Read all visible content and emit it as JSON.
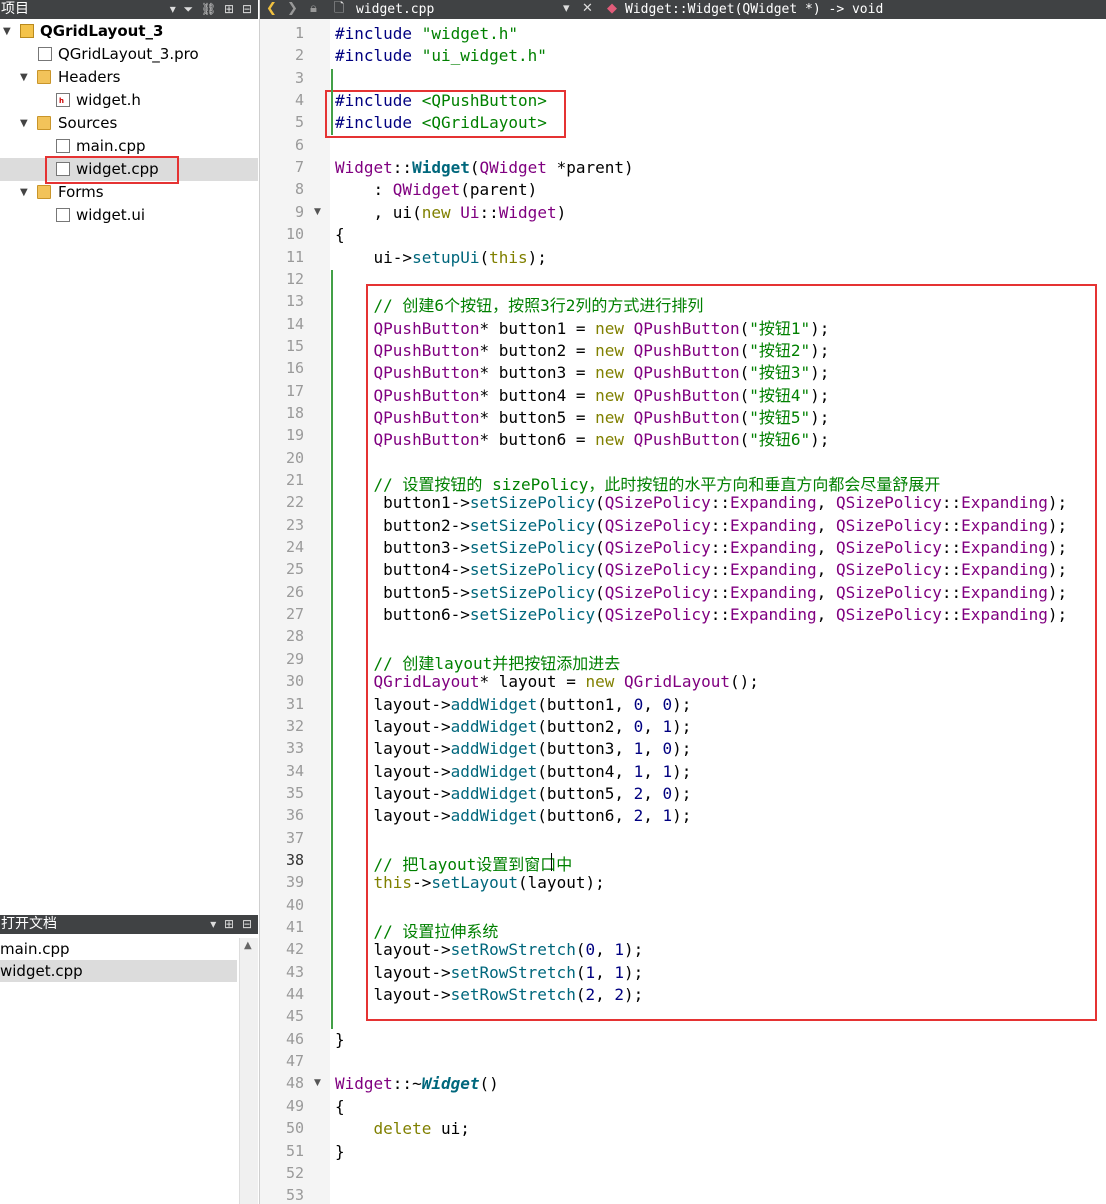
{
  "project_panel": {
    "title": "项目",
    "tree": [
      {
        "label": "QGridLayout_3",
        "kind": "project"
      },
      {
        "label": "QGridLayout_3.pro",
        "kind": "pro-file"
      },
      {
        "label": "Headers",
        "kind": "folder"
      },
      {
        "label": "widget.h",
        "kind": "header-file"
      },
      {
        "label": "Sources",
        "kind": "folder"
      },
      {
        "label": "main.cpp",
        "kind": "source-file"
      },
      {
        "label": "widget.cpp",
        "kind": "source-file",
        "selected": true
      },
      {
        "label": "Forms",
        "kind": "folder"
      },
      {
        "label": "widget.ui",
        "kind": "ui-file"
      }
    ]
  },
  "open_docs_panel": {
    "title": "打开文档",
    "items": [
      {
        "label": "main.cpp"
      },
      {
        "label": "widget.cpp",
        "selected": true
      }
    ]
  },
  "editor_toolbar": {
    "file_name": "widget.cpp",
    "function_path": "Widget::Widget(QWidget *) -> void"
  },
  "current_line": 38,
  "code_lines": [
    "#include \"widget.h\"",
    "#include \"ui_widget.h\"",
    "",
    "#include <QPushButton>",
    "#include <QGridLayout>",
    "",
    "Widget::Widget(QWidget *parent)",
    "    : QWidget(parent)",
    "    , ui(new Ui::Widget)",
    "{",
    "    ui->setupUi(this);",
    "",
    "    // 创建6个按钮，按照3行2列的方式进行排列",
    "    QPushButton* button1 = new QPushButton(\"按钮1\");",
    "    QPushButton* button2 = new QPushButton(\"按钮2\");",
    "    QPushButton* button3 = new QPushButton(\"按钮3\");",
    "    QPushButton* button4 = new QPushButton(\"按钮4\");",
    "    QPushButton* button5 = new QPushButton(\"按钮5\");",
    "    QPushButton* button6 = new QPushButton(\"按钮6\");",
    "",
    "    // 设置按钮的 sizePolicy，此时按钮的水平方向和垂直方向都会尽量舒展开",
    "     button1->setSizePolicy(QSizePolicy::Expanding, QSizePolicy::Expanding);",
    "     button2->setSizePolicy(QSizePolicy::Expanding, QSizePolicy::Expanding);",
    "     button3->setSizePolicy(QSizePolicy::Expanding, QSizePolicy::Expanding);",
    "     button4->setSizePolicy(QSizePolicy::Expanding, QSizePolicy::Expanding);",
    "     button5->setSizePolicy(QSizePolicy::Expanding, QSizePolicy::Expanding);",
    "     button6->setSizePolicy(QSizePolicy::Expanding, QSizePolicy::Expanding);",
    "",
    "    // 创建layout并把按钮添加进去",
    "    QGridLayout* layout = new QGridLayout();",
    "    layout->addWidget(button1, 0, 0);",
    "    layout->addWidget(button2, 0, 1);",
    "    layout->addWidget(button3, 1, 0);",
    "    layout->addWidget(button4, 1, 1);",
    "    layout->addWidget(button5, 2, 0);",
    "    layout->addWidget(button6, 2, 1);",
    "",
    "    // 把layout设置到窗口中",
    "    this->setLayout(layout);",
    "",
    "    // 设置拉伸系统",
    "    layout->setRowStretch(0, 1);",
    "    layout->setRowStretch(1, 1);",
    "    layout->setRowStretch(2, 2);",
    "",
    "}",
    "",
    "Widget::~Widget()",
    "{",
    "    delete ui;",
    "}",
    "",
    ""
  ],
  "colors": {
    "toolbar_bg": "#404244",
    "keyword": "#808000",
    "string": "#008000",
    "type": "#800080",
    "comment": "#008000",
    "highlight_box": "#e53333",
    "change_marker": "#43a047"
  }
}
